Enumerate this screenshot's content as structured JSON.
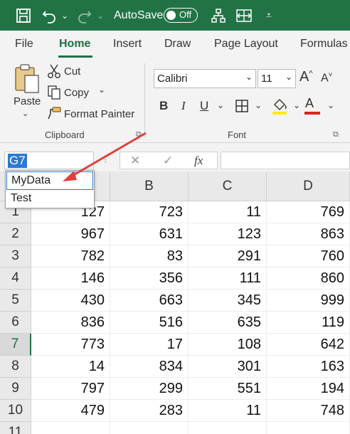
{
  "titlebar": {
    "autosave_label": "AutoSave",
    "autosave_state": "Off",
    "icons": [
      "save-icon",
      "undo-icon",
      "redo-icon",
      "org-chart-icon",
      "fit-columns-icon",
      "customize-dropdown-icon"
    ]
  },
  "tabs": [
    "File",
    "Home",
    "Insert",
    "Draw",
    "Page Layout",
    "Formulas"
  ],
  "ribbon": {
    "clipboard": {
      "paste": "Paste",
      "cut": "Cut",
      "copy": "Copy",
      "format_painter": "Format Painter",
      "group_label": "Clipboard"
    },
    "font": {
      "font_name": "Calibri",
      "font_size": "11",
      "grow": "A",
      "shrink": "A",
      "bold": "B",
      "italic": "I",
      "underline": "U",
      "font_color": "A",
      "group_label": "Font"
    }
  },
  "formula_bar": {
    "name_box": "G7",
    "cancel": "✕",
    "enter": "✓",
    "fx": "fx"
  },
  "name_dropdown": [
    "MyData",
    "Test"
  ],
  "columns": [
    "B",
    "C",
    "D"
  ],
  "rows": [
    {
      "num": "1",
      "a": "127",
      "b": "723",
      "c": "11",
      "d": "769"
    },
    {
      "num": "2",
      "a": "967",
      "b": "631",
      "c": "123",
      "d": "863"
    },
    {
      "num": "3",
      "a": "782",
      "b": "83",
      "c": "291",
      "d": "760"
    },
    {
      "num": "4",
      "a": "146",
      "b": "356",
      "c": "111",
      "d": "860"
    },
    {
      "num": "5",
      "a": "430",
      "b": "663",
      "c": "345",
      "d": "999"
    },
    {
      "num": "6",
      "a": "836",
      "b": "516",
      "c": "635",
      "d": "119"
    },
    {
      "num": "7",
      "a": "773",
      "b": "17",
      "c": "108",
      "d": "642"
    },
    {
      "num": "8",
      "a": "14",
      "b": "834",
      "c": "301",
      "d": "163"
    },
    {
      "num": "9",
      "a": "797",
      "b": "299",
      "c": "551",
      "d": "194"
    },
    {
      "num": "10",
      "a": "479",
      "b": "283",
      "c": "11",
      "d": "748"
    },
    {
      "num": "11",
      "a": "",
      "b": "",
      "c": "",
      "d": ""
    }
  ],
  "colors": {
    "title_green": "#217346",
    "selection_blue": "#2b79d6",
    "arrow_red": "#e0403a",
    "highlight_yellow": "#ffeb00",
    "font_red": "#e02020"
  }
}
